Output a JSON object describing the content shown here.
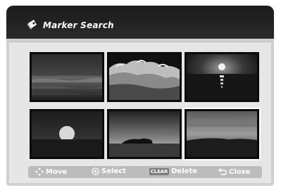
{
  "window": {
    "title": "Marker Search",
    "title_icon": "marker-search-icon"
  },
  "thumbnails": [
    {
      "scene": "ocean-waves-dusk",
      "selected": false
    },
    {
      "scene": "crashing-wave",
      "selected": false
    },
    {
      "scene": "sun-over-sea",
      "selected": false
    },
    {
      "scene": "setting-sun-horizon",
      "selected": false
    },
    {
      "scene": "island-silhouette",
      "selected": false
    },
    {
      "scene": "cloudy-sky-shore",
      "selected": true
    }
  ],
  "help_bar": {
    "move": {
      "icon": "arrows-icon",
      "label": "Move"
    },
    "select": {
      "icon": "select-circle-icon",
      "label": "Select"
    },
    "delete": {
      "badge": "CLEAR",
      "label": "Delete"
    },
    "close": {
      "icon": "return-icon",
      "label": "Close"
    }
  }
}
